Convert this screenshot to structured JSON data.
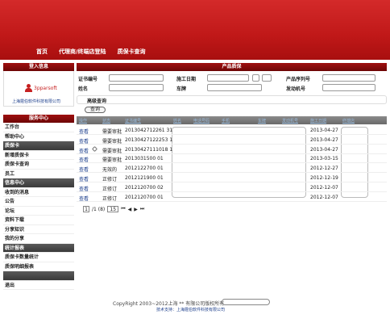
{
  "header": {
    "nav": [
      "首页",
      "代理商/终端店登陆",
      "质保卡查询"
    ]
  },
  "sidebar": {
    "login_title": "登入信息",
    "user_name": "3pparsoft",
    "company": "上海霆伯软件科技有限公司",
    "service_title": "服务中心",
    "items": [
      {
        "label": "工作台",
        "group": false
      },
      {
        "label": "帮助中心",
        "group": false
      },
      {
        "label": "质保卡",
        "group": true
      },
      {
        "label": "新增质保卡",
        "group": false
      },
      {
        "label": "质保卡查询",
        "group": false
      },
      {
        "label": "员工",
        "group": false
      },
      {
        "label": "信息中心",
        "group": true
      },
      {
        "label": "收到的消息",
        "group": false
      },
      {
        "label": "公告",
        "group": false
      },
      {
        "label": "论坛",
        "group": false
      },
      {
        "label": "资料下载",
        "group": false
      },
      {
        "label": "分享知识",
        "group": false
      },
      {
        "label": "我的分享",
        "group": false
      },
      {
        "label": "统计报表",
        "group": true
      },
      {
        "label": "质保卡数量统计",
        "group": false
      },
      {
        "label": "质保明细报表",
        "group": false
      },
      {
        "label": "",
        "group": true
      },
      {
        "label": "退出",
        "group": false
      }
    ]
  },
  "main": {
    "title": "产品质保",
    "labels": {
      "cert": "证书编号",
      "date": "施工日期",
      "serial": "产品序列号",
      "name": "姓名",
      "plate": "车牌",
      "engine": "发动机号"
    },
    "advanced": "高级查询",
    "query": "查询",
    "columns": [
      "操作",
      "状态",
      "证书编号",
      "姓名",
      "电话号码",
      "手机",
      "车牌",
      "发动机号",
      "施工日期",
      "终端店"
    ],
    "rows": [
      {
        "action": "查看",
        "status": "需要审批",
        "cert": "2013042712261 31",
        "date": "2013-04-27"
      },
      {
        "action": "查看",
        "status": "需要审批",
        "cert": "20130427122253 1",
        "date": "2013-04-27"
      },
      {
        "action": "查看",
        "status": "需要审批",
        "cert": "20130427111018 1",
        "date": "2013-04-27"
      },
      {
        "action": "查看",
        "status": "需要审批",
        "cert": "2013031500 01",
        "date": "2013-03-15"
      },
      {
        "action": "查看",
        "status": "无效的",
        "cert": "2012122700 01",
        "date": "2012-12-27"
      },
      {
        "action": "查看",
        "status": "正修订",
        "cert": "2012121900 01",
        "date": "2012-12-19"
      },
      {
        "action": "查看",
        "status": "正修订",
        "cert": "2012120700 02",
        "date": "2012-12-07"
      },
      {
        "action": "查看",
        "status": "正修订",
        "cert": "2012120700 01",
        "date": "2012-12-07"
      }
    ],
    "pager": {
      "current": "1",
      "total_text": "/1 (8)",
      "page_size": "15"
    }
  },
  "footer": {
    "copyright": "CopyRight 2003~2012上海 ** 有限公司版权所有",
    "support": "技术支持：上海霆伯软件科技有限公司"
  }
}
